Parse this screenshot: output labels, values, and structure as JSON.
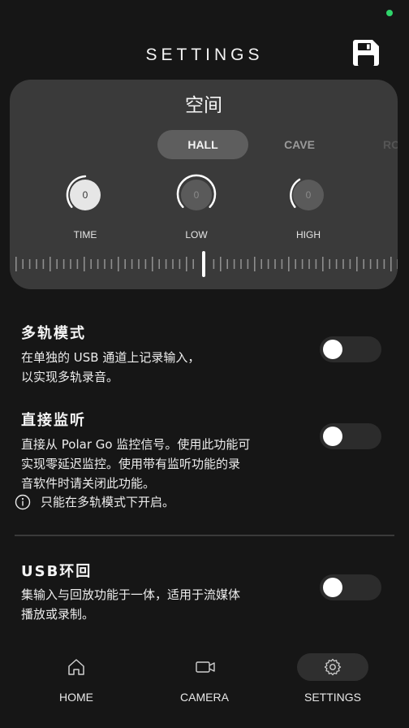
{
  "status": {
    "indicator_color": "#2fd46a"
  },
  "header": {
    "title": "SETTINGS",
    "save_icon": "save-icon"
  },
  "space_card": {
    "title": "空间",
    "presets": [
      "HALL",
      "CAVE",
      "ROO"
    ],
    "selected_preset": "HALL",
    "knobs": [
      {
        "label": "TIME",
        "value": "0"
      },
      {
        "label": "LOW",
        "value": "0"
      },
      {
        "label": "HIGH",
        "value": "0"
      }
    ]
  },
  "settings": {
    "multitrack": {
      "title": "多轨模式",
      "desc_line1": "在单独的 USB 通道上记录输入，",
      "desc_line2": "以实现多轨录音。",
      "enabled": false
    },
    "monitor": {
      "title": "直接监听",
      "desc_line1": "直接从 Polar Go 监控信号。使用此功能可",
      "desc_line2": "实现零延迟监控。使用带有监听功能的录",
      "desc_line3": "音软件时请关闭此功能。",
      "info": "只能在多轨模式下开启。",
      "enabled": false
    },
    "usb_loopback": {
      "title": "USB环回",
      "desc_line1": "集输入与回放功能于一体，适用于流媒体",
      "desc_line2": "播放或录制。",
      "enabled": false
    }
  },
  "bottom_nav": {
    "home": "HOME",
    "camera": "CAMERA",
    "settings": "SETTINGS",
    "active": "settings"
  }
}
